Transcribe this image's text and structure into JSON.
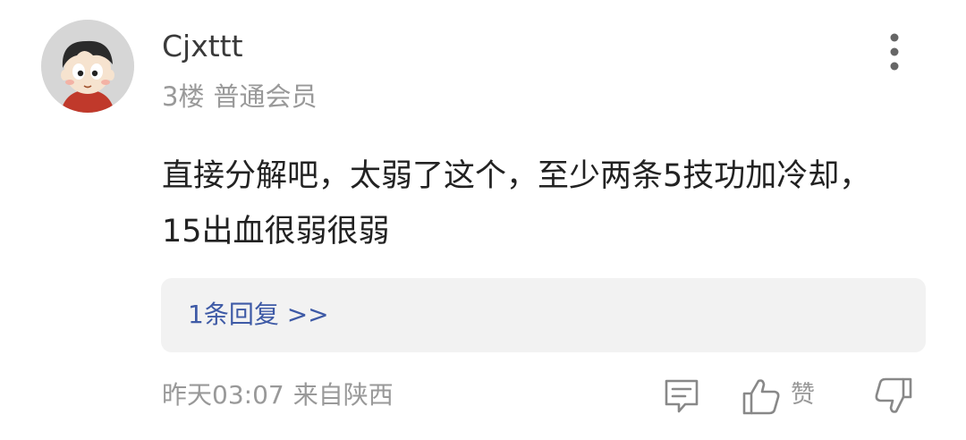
{
  "comment": {
    "username": "Cjxttt",
    "floor": "3楼",
    "member_level": "普通会员",
    "content": "直接分解吧，太弱了这个，至少两条5技功加冷却，15出血很弱很弱",
    "reply_link": "1条回复 >>",
    "time": "昨天03:07",
    "location": "来自陕西",
    "like_label": "赞"
  },
  "icons": {
    "more": "more-vertical-icon",
    "comment": "comment-icon",
    "like": "thumbs-up-icon",
    "dislike": "thumbs-down-icon"
  },
  "colors": {
    "reply_link": "#3e5aa6",
    "meta_text": "#999999",
    "reply_bg": "#f2f2f2"
  }
}
